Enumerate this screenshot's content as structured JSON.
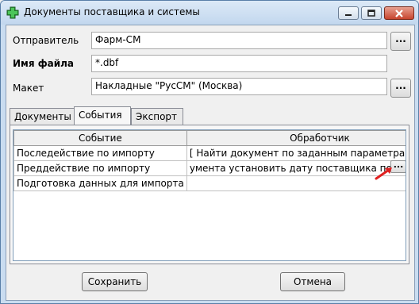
{
  "window": {
    "title": "Документы поставщика и системы",
    "icon": "pharmacy-cross-icon",
    "minimize": "minimize-icon",
    "maximize": "maximize-icon",
    "close": "close-icon"
  },
  "form": {
    "sender_label": "Отправитель",
    "sender_value": "Фарм-СМ",
    "filename_label": "Имя файла",
    "filename_value": "*.dbf",
    "template_label": "Макет",
    "template_value": "Накладные \"РусСМ\" (Москва)",
    "browse_label": "..."
  },
  "tabs": [
    {
      "label": "Документы"
    },
    {
      "label": "События",
      "active": true
    },
    {
      "label": "Экспорт"
    }
  ],
  "grid": {
    "columns": [
      "Событие",
      "Обработчик"
    ],
    "rows": [
      {
        "event": "Последействие по импорту",
        "handler": "[ Найти документ по заданным параметрам (номер"
      },
      {
        "event": "Преддействие по импорту",
        "handler": "умента установить дату поставщика по запросу] "
      },
      {
        "event": "Подготовка данных для импорта",
        "handler": ""
      }
    ],
    "cell_button_label": "..."
  },
  "buttons": {
    "save": "Сохранить",
    "cancel": "Отмена"
  },
  "colors": {
    "titlebar": "#c9dcf0",
    "arrow": "#e02020"
  }
}
